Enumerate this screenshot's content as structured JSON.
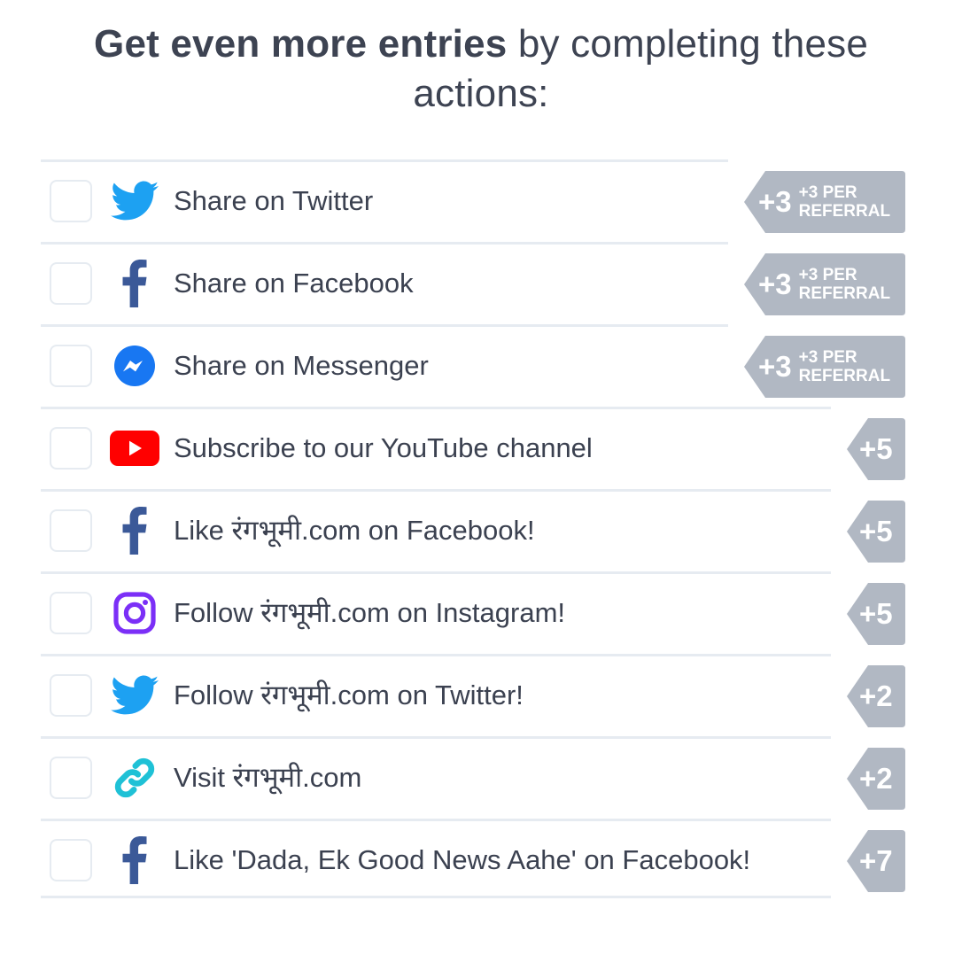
{
  "heading": {
    "bold": "Get even more entries",
    "rest": " by completing these actions:"
  },
  "actions": [
    {
      "label": "Share on Twitter",
      "icon": "twitter-icon",
      "points": "+3",
      "extra_1": "+3 PER",
      "extra_2": "REFERRAL"
    },
    {
      "label": "Share on Facebook",
      "icon": "facebook-icon",
      "points": "+3",
      "extra_1": "+3 PER",
      "extra_2": "REFERRAL"
    },
    {
      "label": "Share on Messenger",
      "icon": "messenger-icon",
      "points": "+3",
      "extra_1": "+3 PER",
      "extra_2": "REFERRAL"
    },
    {
      "label": "Subscribe to our YouTube channel",
      "icon": "youtube-icon",
      "points": "+5"
    },
    {
      "label": "Like रंगभूमी.com on Facebook!",
      "icon": "facebook-icon",
      "points": "+5"
    },
    {
      "label": "Follow रंगभूमी.com on Instagram!",
      "icon": "instagram-icon",
      "points": "+5"
    },
    {
      "label": "Follow रंगभूमी.com on Twitter!",
      "icon": "twitter-icon",
      "points": "+2"
    },
    {
      "label": "Visit रंगभूमी.com",
      "icon": "link-icon",
      "points": "+2"
    },
    {
      "label": "Like 'Dada, Ek Good News Aahe' on Facebook!",
      "icon": "facebook-icon",
      "points": "+7"
    }
  ],
  "colors": {
    "twitter": "#1da1f2",
    "facebook": "#3b5998",
    "messenger": "#1877f2",
    "youtube": "#ff0000",
    "instagram": "#7b2ff7",
    "link": "#1fc1d6",
    "badge": "#b1b8c3",
    "border": "#e6ebf1",
    "text": "#3b4150"
  }
}
